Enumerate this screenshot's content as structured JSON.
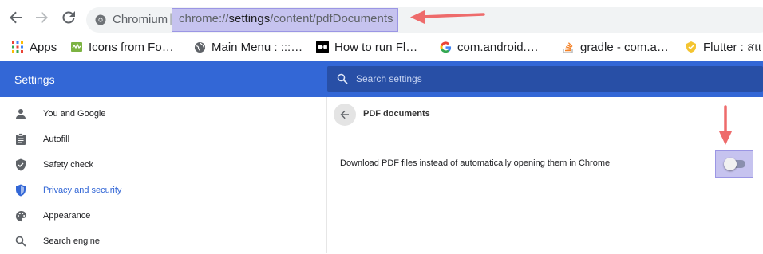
{
  "browser": {
    "omnibox": {
      "origin_label": "Chromium",
      "separator": "|",
      "url_scheme": "chrome://",
      "url_host": "settings",
      "url_path": "/content/pdfDocuments"
    },
    "bookmarks": [
      {
        "label": "Apps",
        "icon": "apps-grid-icon"
      },
      {
        "label": "Icons from Fo…",
        "icon": "green-bookmark-icon"
      },
      {
        "label": "Main Menu : :::…",
        "icon": "globe-icon"
      },
      {
        "label": "How to run Fl…",
        "icon": "medium-logo-icon"
      },
      {
        "label": "com.android.…",
        "icon": "google-icon"
      },
      {
        "label": "gradle - com.a…",
        "icon": "stackoverflow-icon"
      },
      {
        "label": "Flutter : สแ",
        "icon": "yellow-bookmark-icon"
      }
    ]
  },
  "settings": {
    "title": "Settings",
    "search_placeholder": "Search settings",
    "sidebar": [
      {
        "label": "You and Google",
        "icon": "person-icon",
        "active": false
      },
      {
        "label": "Autofill",
        "icon": "clipboard-icon",
        "active": false
      },
      {
        "label": "Safety check",
        "icon": "shield-check-icon",
        "active": false
      },
      {
        "label": "Privacy and security",
        "icon": "shield-icon",
        "active": true
      },
      {
        "label": "Appearance",
        "icon": "palette-icon",
        "active": false
      },
      {
        "label": "Search engine",
        "icon": "search-icon",
        "active": false
      }
    ],
    "page": {
      "title": "PDF documents",
      "preference_label": "Download PDF files instead of automatically opening them in Chrome",
      "preference_enabled": false
    }
  },
  "colors": {
    "accent": "#3367d6",
    "annotation_highlight": "#c6c3ef",
    "annotation_arrow": "#ee6b6b"
  }
}
